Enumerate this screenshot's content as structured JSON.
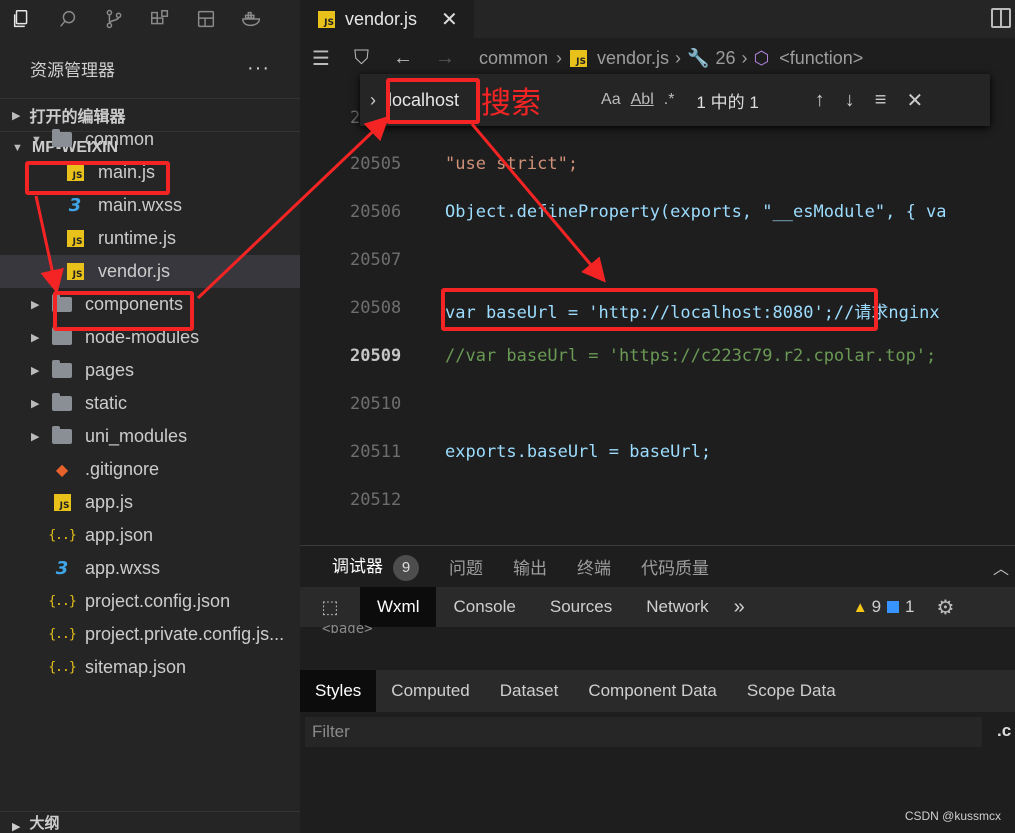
{
  "tabs": [
    {
      "label": "vendor.js",
      "icon": "js-file-icon",
      "close": "✕"
    }
  ],
  "sidebar": {
    "title": "资源管理器",
    "more": "···",
    "section_open_editors": "打开的编辑器",
    "section_project": "MP-WEIXIN",
    "outline": "大纲",
    "tree": [
      {
        "label": "common",
        "type": "folder-open"
      },
      {
        "label": "main.js",
        "type": "js"
      },
      {
        "label": "main.wxss",
        "type": "css"
      },
      {
        "label": "runtime.js",
        "type": "js"
      },
      {
        "label": "vendor.js",
        "type": "js"
      },
      {
        "label": "components",
        "type": "folder"
      },
      {
        "label": "node-modules",
        "type": "folder"
      },
      {
        "label": "pages",
        "type": "folder"
      },
      {
        "label": "static",
        "type": "folder"
      },
      {
        "label": "uni_modules",
        "type": "folder"
      },
      {
        "label": ".gitignore",
        "type": "git"
      },
      {
        "label": "app.js",
        "type": "js"
      },
      {
        "label": "app.json",
        "type": "json"
      },
      {
        "label": "app.wxss",
        "type": "css"
      },
      {
        "label": "project.config.json",
        "type": "json"
      },
      {
        "label": "project.private.config.js...",
        "type": "json"
      },
      {
        "label": "sitemap.json",
        "type": "json"
      }
    ]
  },
  "breadcrumb": {
    "folder": "common",
    "file": "vendor.js",
    "line": "26",
    "symbol": "<function>"
  },
  "find": {
    "query": "localhost",
    "annotation": "搜索",
    "opt_case": "Aa",
    "opt_word": "Abl",
    "opt_regex": ".*",
    "result": "1 中的 1"
  },
  "editor": {
    "lines": [
      {
        "num": "20505",
        "code": "\"use strict\";"
      },
      {
        "num": "20506",
        "code": "Object.defineProperty(exports, \"__esModule\", { va"
      },
      {
        "num": "20507",
        "code": ""
      },
      {
        "num": "20508",
        "code": "var baseUrl = 'http://localhost:8080';//请求nginx"
      },
      {
        "num": "20509",
        "code": "//var baseUrl = 'https://c223c79.r2.cpolar.top';"
      },
      {
        "num": "20510",
        "code": ""
      },
      {
        "num": "20511",
        "code": "exports.baseUrl = baseUrl;"
      },
      {
        "num": "20512",
        "code": ""
      }
    ],
    "hidden_line_prefix": "2"
  },
  "panel": {
    "tabs": [
      "调试器",
      "问题",
      "输出",
      "终端",
      "代码质量"
    ],
    "debugger_count": "9",
    "devtools_tabs": [
      "Wxml",
      "Console",
      "Sources",
      "Network"
    ],
    "more": "»",
    "warnings": "9",
    "messages": "1",
    "page_tag": "<page>",
    "style_tabs": [
      "Styles",
      "Computed",
      "Dataset",
      "Component Data",
      "Scope Data"
    ],
    "filter_placeholder": "Filter",
    "filter_suffix": ".c"
  },
  "watermark": "CSDN @kussmcx",
  "colors": {
    "accent_red": "#f52424",
    "selected_row": "#37373d",
    "js_yellow": "#e8c21a"
  }
}
